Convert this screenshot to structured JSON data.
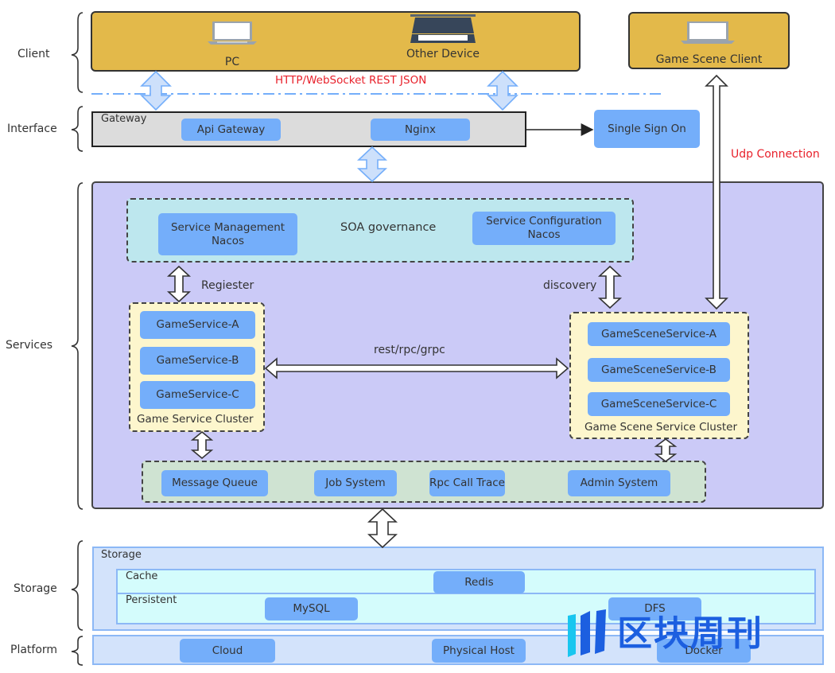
{
  "layers": {
    "client": "Client",
    "interface": "Interface",
    "services": "Services",
    "storage": "Storage",
    "platform": "Platform"
  },
  "client": {
    "pc": {
      "label": "PC",
      "icon": "laptop-icon"
    },
    "other_device": {
      "label": "Other Device",
      "icon": "tablet-device-icon"
    },
    "game_scene_client": {
      "label": "Game Scene Client",
      "icon": "laptop-icon"
    },
    "protocol_label": "HTTP/WebSocket REST JSON"
  },
  "interface": {
    "title": "Gateway",
    "api_gateway": "Api Gateway",
    "nginx": "Nginx",
    "sso": "Single Sign On"
  },
  "udp_label": "Udp Connection",
  "services": {
    "soa": {
      "title": "SOA governance",
      "service_management": "Service Management\nNacos",
      "service_configuration": "Service Configuration\nNacos"
    },
    "register_label": "Regiester",
    "discovery_label": "discovery",
    "rpc_label": "rest/rpc/grpc",
    "game_cluster": {
      "title": "Game Service Cluster",
      "items": [
        "GameService-A",
        "GameService-B",
        "GameService-C"
      ]
    },
    "scene_cluster": {
      "title": "Game Scene Service Cluster",
      "items": [
        "GameSceneService-A",
        "GameSceneService-B",
        "GameSceneService-C"
      ]
    },
    "infra": [
      "Message Queue",
      "Job System",
      "Rpc Call Trace",
      "Admin System"
    ]
  },
  "storage": {
    "title": "Storage",
    "cache": {
      "title": "Cache",
      "items": [
        "Redis"
      ]
    },
    "persistent": {
      "title": "Persistent",
      "items": [
        "MySQL",
        "DFS"
      ]
    }
  },
  "platform": {
    "items": [
      "Cloud",
      "Physical Host",
      "Docker"
    ]
  },
  "watermark": "区块周刊",
  "colors": {
    "client_fill": "#e3b94a",
    "services_fill": "#cbcaf7",
    "soa_fill": "#bde7ee",
    "cluster_fill": "#fdf6cd",
    "infra_fill": "#cfe3d2",
    "node_fill": "#74aefa",
    "storage_fill": "#d3e3fb",
    "cache_fill": "#d4fcfc",
    "protocol_text": "#e8212b",
    "watermark": "#1c5fe0"
  }
}
